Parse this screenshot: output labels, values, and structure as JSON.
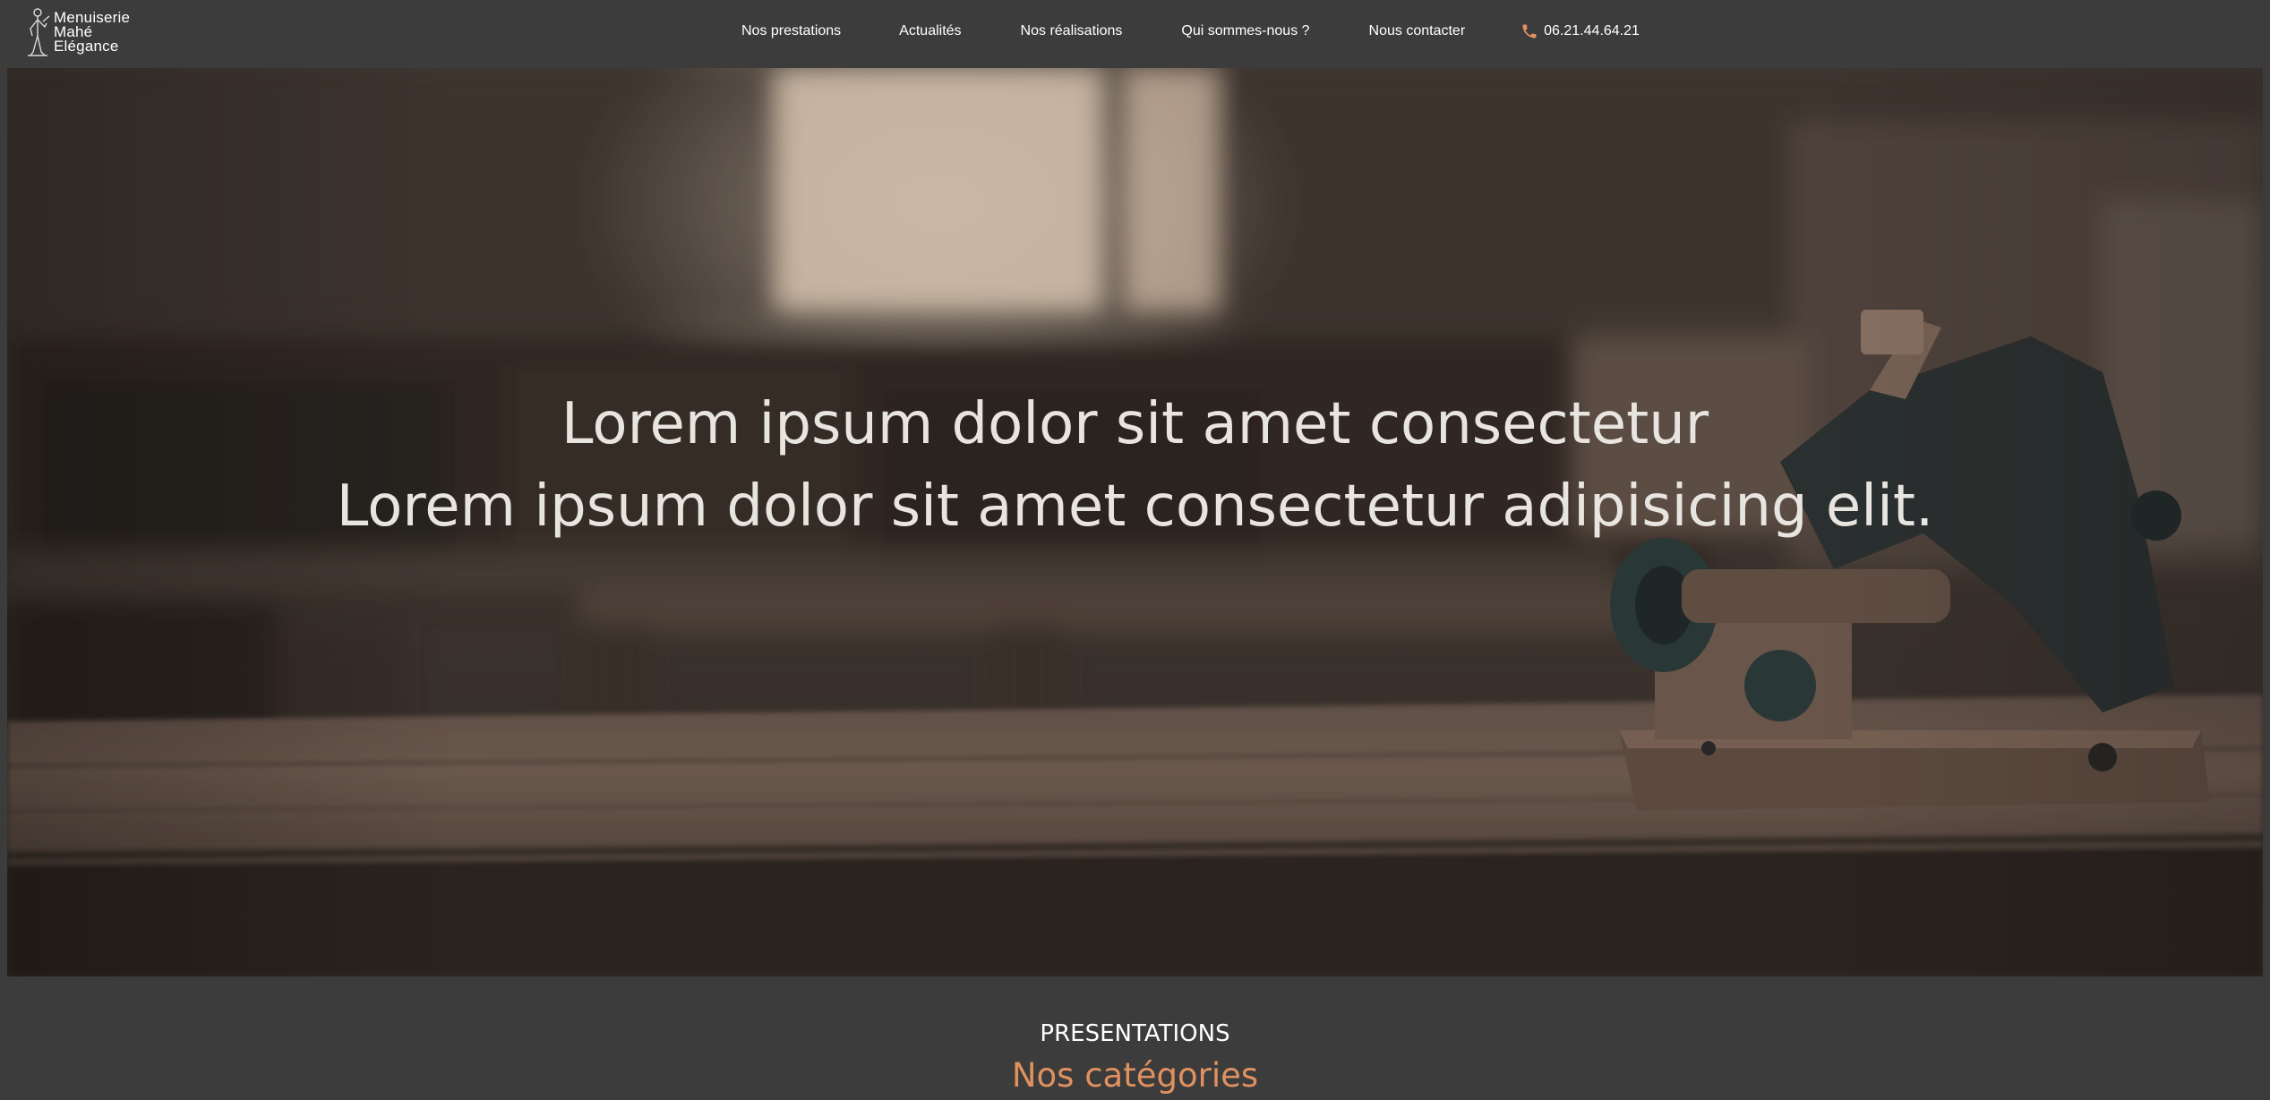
{
  "brand": {
    "lines": [
      "Menuiserie",
      "Mahé",
      "Elégance"
    ],
    "logo_icon": "craftsman-figure-icon"
  },
  "nav": {
    "items": [
      {
        "label": "Nos prestations"
      },
      {
        "label": "Actualités"
      },
      {
        "label": "Nos réalisations"
      },
      {
        "label": "Qui sommes-nous ?"
      },
      {
        "label": "Nous contacter"
      }
    ],
    "phone": {
      "number": "06.21.44.64.21",
      "icon": "phone-icon",
      "icon_color": "#e0915f"
    }
  },
  "hero": {
    "line1": "Lorem ipsum dolor sit amet consectetur",
    "line2": "Lorem ipsum dolor sit amet consectetur adipisicing elit."
  },
  "section": {
    "kicker": "PRESENTATIONS",
    "title": "Nos catégories"
  },
  "colors": {
    "background": "#3c3c3c",
    "accent": "#e0915f",
    "text": "#ffffff"
  }
}
